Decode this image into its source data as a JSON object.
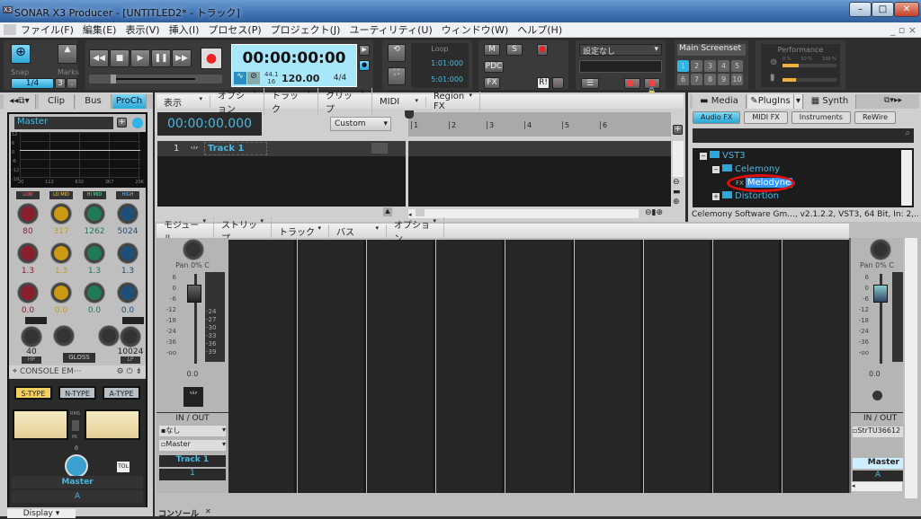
{
  "window": {
    "title": "SONAR X3 Producer - [UNTITLED2* - トラック]",
    "app_icon": "X3",
    "min": "–",
    "max": "□",
    "close": "✕"
  },
  "menu": [
    "ファイル(F)",
    "編集(E)",
    "表示(V)",
    "挿入(I)",
    "プロセス(P)",
    "プロジェクト(J)",
    "ユーティリティ(U)",
    "ウィンドウ(W)",
    "ヘルプ(H)"
  ],
  "control_bar": {
    "snap_label": "Snap",
    "snap_value": "1/4",
    "snap_triplet": "3",
    "snap_dot": ".",
    "marks_label": "Marks",
    "transport": {
      "rewind": "◀◀",
      "stop": "■",
      "play": "▶",
      "pause": "❚❚",
      "forward": "▶▶",
      "record": "●"
    },
    "time": "00:00:00:00",
    "sample_rate": "44.1",
    "bit_depth": "16",
    "tempo": "120.00",
    "meter": "4/4",
    "loop_label": "Loop",
    "loop_start": "1:01:000",
    "loop_end": "5:01:000",
    "mix": {
      "m": "M",
      "s": "S",
      "pdc": "PDC",
      "fx": "FX",
      "r": "R!"
    },
    "preset": "設定なし",
    "screenset": {
      "label": "Main Screenset",
      "buttons": [
        "1",
        "2",
        "3",
        "4",
        "5",
        "6",
        "7",
        "8",
        "9",
        "10"
      ],
      "active": "1"
    },
    "performance": {
      "label": "Performance",
      "scale": [
        "0 %",
        "50 %",
        "100 %"
      ],
      "cpu_fraction": 0.3,
      "disk_fraction": 0.25
    }
  },
  "inspector": {
    "tabs": [
      "Clip",
      "Bus",
      "ProCh"
    ],
    "active_tab": "ProCh",
    "name": "Master",
    "eq": {
      "y_ticks": [
        "12",
        "6",
        "0",
        "-6",
        "-12",
        "-18"
      ],
      "x_ticks": [
        "20",
        "112",
        "632",
        "3K7",
        "20K"
      ],
      "bands": [
        {
          "label": "LOW",
          "color": "#8b1e2a",
          "freq": "80",
          "q": "1.3",
          "gain": "0.0"
        },
        {
          "label": "LO MID",
          "color": "#c99a12",
          "freq": "317",
          "q": "1.3",
          "gain": "0.0"
        },
        {
          "label": "HI MID",
          "color": "#1f7a56",
          "freq": "1262",
          "q": "1.3",
          "gain": "0.0"
        },
        {
          "label": "HIGH",
          "color": "#1f4e78",
          "freq": "5024",
          "q": "1.3",
          "gain": "0.0"
        }
      ],
      "hp": "40",
      "hp_label": "HP",
      "lp": "10024",
      "lp_label": "LP",
      "gloss": "GLOSS"
    },
    "console_title": "CONSOLE EM···",
    "types": [
      "S-TYPE",
      "N-TYPE",
      "A-TYPE"
    ],
    "active_type": "S-TYPE",
    "meter_rms": "RMS",
    "meter_pk": "PK",
    "tol": "TOL",
    "drive_zero": "0",
    "footer_name": "Master",
    "footer_id": "A",
    "display": "Display"
  },
  "track_view": {
    "menus": [
      "表示",
      "オプション",
      "トラック",
      "クリップ",
      "MIDI",
      "Region FX"
    ],
    "time": "00:00:00.000",
    "preset": "Custom",
    "ruler": [
      "1",
      "2",
      "3",
      "4",
      "5",
      "6"
    ],
    "tracks": [
      {
        "number": "1",
        "name": "Track 1"
      }
    ]
  },
  "browser": {
    "tabs": [
      "Media",
      "PlugIns",
      "Synth"
    ],
    "active_tab": "PlugIns",
    "filters": [
      "Audio FX",
      "MIDI FX",
      "Instruments",
      "ReWire"
    ],
    "active_filter": "Audio FX",
    "search_placeholder": "",
    "tree": [
      {
        "label": "VST3",
        "level": 0,
        "toggle": "−"
      },
      {
        "label": "Celemony",
        "level": 1,
        "toggle": "−"
      },
      {
        "label": "Melodyne",
        "level": 2,
        "selected": true,
        "icon": "FX"
      },
      {
        "label": "Distortion",
        "level": 1,
        "toggle": "+"
      }
    ],
    "status": "Celemony Software Gm..., v2.1.2.2, VST3, 64 Bit, In: 2,..."
  },
  "console": {
    "menus": [
      "モジュール",
      "ストリップ",
      "トラック",
      "バス",
      "オプション"
    ],
    "track_strip": {
      "pan": "Pan 0% C",
      "fader_ticks": [
        "6",
        "0",
        "-6",
        "-12",
        "-18",
        "-24",
        "-36",
        "-oo"
      ],
      "meter_ticks": [
        "-24",
        "-27",
        "-30",
        "-33",
        "-36",
        "-39"
      ],
      "volume": "0.0",
      "io_label": "IN / OUT",
      "input": "なし",
      "output": "Master",
      "name": "Track 1",
      "number": "1"
    },
    "master_strip": {
      "pan": "Pan 0% C",
      "fader_ticks": [
        "6",
        "0",
        "-6",
        "-12",
        "-18",
        "-24",
        "-36",
        "-oo"
      ],
      "volume": "0.0",
      "io_label": "IN / OUT",
      "output": "StrTU36612",
      "name": "Master",
      "id": "A"
    }
  },
  "bottom": {
    "tab": "コンソール",
    "tab_close": "✕"
  },
  "colors": {
    "accent": "#2fb4e6",
    "highlight_ring": "#e01010"
  }
}
